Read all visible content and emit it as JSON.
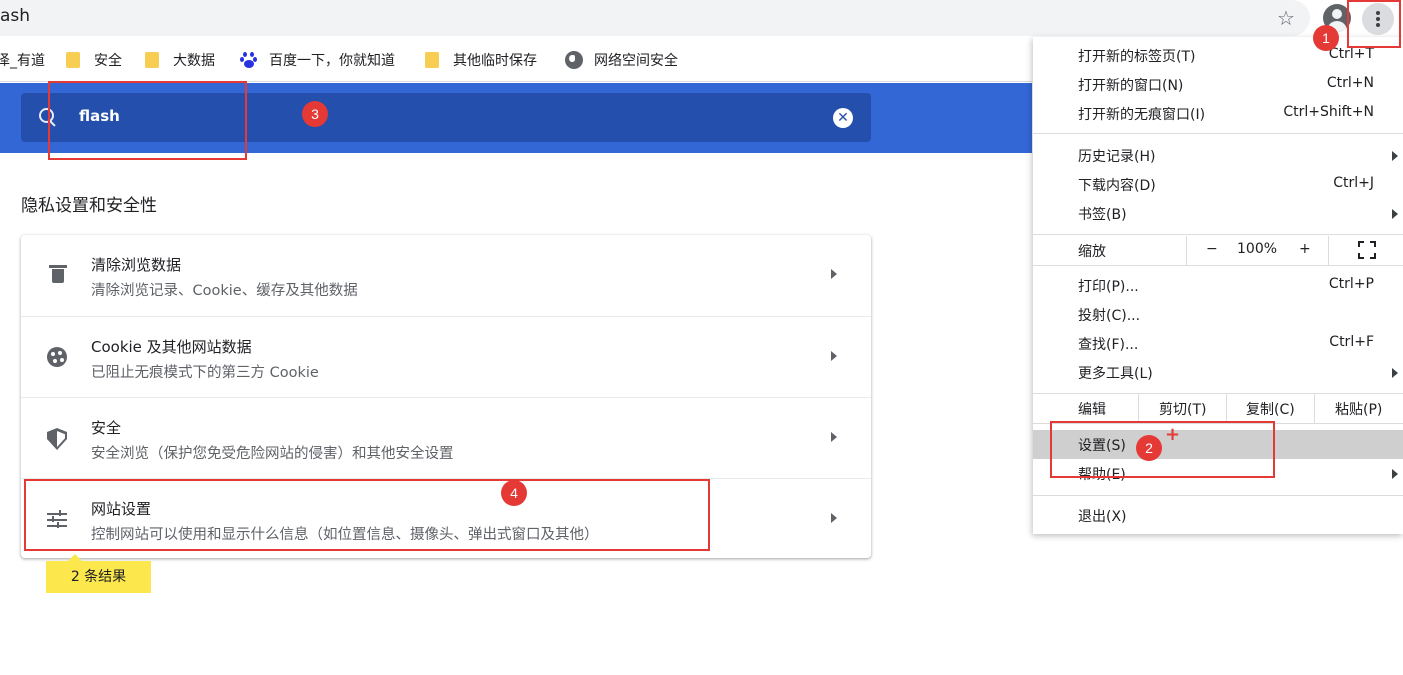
{
  "omnibox": {
    "text": "ash"
  },
  "bookmarks": [
    {
      "label": "泽_有道",
      "icon": "none"
    },
    {
      "label": "安全",
      "icon": "folder-icon"
    },
    {
      "label": "大数据",
      "icon": "folder-icon"
    },
    {
      "label": "百度一下，你就知道",
      "icon": "baidu-icon"
    },
    {
      "label": "其他临时保存",
      "icon": "folder-icon"
    },
    {
      "label": "网络空间安全",
      "icon": "globe-icon"
    }
  ],
  "search": {
    "value": "flash"
  },
  "section_title": "隐私设置和安全性",
  "rows": [
    {
      "title": "清除浏览数据",
      "sub": "清除浏览记录、Cookie、缓存及其他数据",
      "icon": "trash-icon"
    },
    {
      "title": "Cookie 及其他网站数据",
      "sub": "已阻止无痕模式下的第三方 Cookie",
      "icon": "cookie-icon"
    },
    {
      "title": "安全",
      "sub": "安全浏览（保护您免受危险网站的侵害）和其他安全设置",
      "icon": "shield-icon"
    },
    {
      "title": "网站设置",
      "sub": "控制网站可以使用和显示什么信息（如位置信息、摄像头、弹出式窗口及其他）",
      "icon": "tune-icon"
    }
  ],
  "results_tooltip": "2 条结果",
  "menu": {
    "new_tab": {
      "label": "打开新的标签页(T)",
      "shortcut": "Ctrl+T"
    },
    "new_window": {
      "label": "打开新的窗口(N)",
      "shortcut": "Ctrl+N"
    },
    "incognito": {
      "label": "打开新的无痕窗口(I)",
      "shortcut": "Ctrl+Shift+N"
    },
    "history": {
      "label": "历史记录(H)"
    },
    "downloads": {
      "label": "下载内容(D)",
      "shortcut": "Ctrl+J"
    },
    "bookmarks": {
      "label": "书签(B)"
    },
    "zoom": {
      "label": "缩放",
      "minus": "−",
      "value": "100%",
      "plus": "+"
    },
    "print": {
      "label": "打印(P)...",
      "shortcut": "Ctrl+P"
    },
    "cast": {
      "label": "投射(C)..."
    },
    "find": {
      "label": "查找(F)...",
      "shortcut": "Ctrl+F"
    },
    "more_tools": {
      "label": "更多工具(L)"
    },
    "edit": {
      "label": "编辑",
      "cut": "剪切(T)",
      "copy": "复制(C)",
      "paste": "粘贴(P)"
    },
    "settings": {
      "label": "设置(S)"
    },
    "help": {
      "label": "帮助(E)"
    },
    "exit": {
      "label": "退出(X)"
    }
  },
  "annotations": {
    "b1": "1",
    "b2": "2",
    "b3": "3",
    "b4": "4",
    "plus": "+"
  },
  "colors": {
    "header_blue": "#3367d6",
    "search_blue": "#254fac",
    "annotation_red": "#e53935",
    "tooltip_yellow": "#fce74c"
  }
}
